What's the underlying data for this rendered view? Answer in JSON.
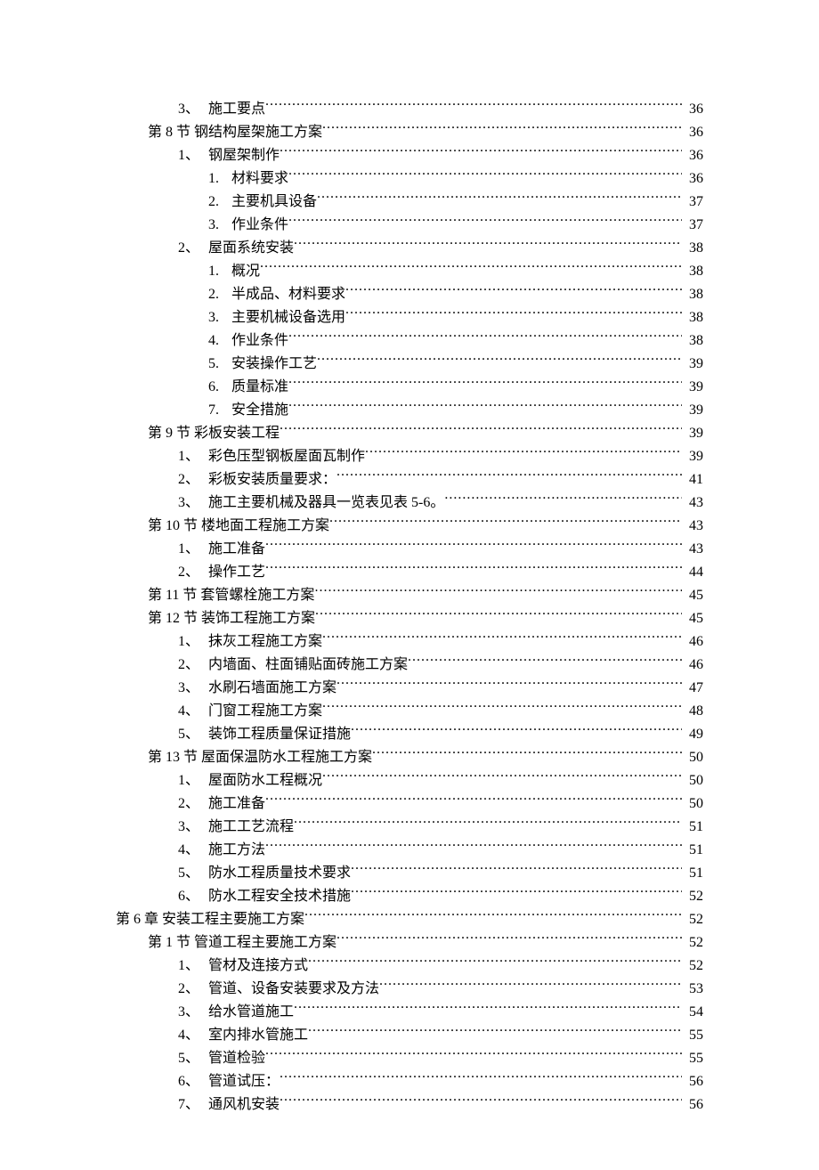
{
  "entries": [
    {
      "indent": 2,
      "num": "3、",
      "title": "施工要点",
      "page": "36"
    },
    {
      "indent": 1,
      "num": "第 8 节",
      "title": " 钢结构屋架施工方案",
      "page": "36"
    },
    {
      "indent": 2,
      "num": "1、",
      "title": "钢屋架制作",
      "page": "36"
    },
    {
      "indent": 3,
      "num": "1.",
      "title": " 材料要求",
      "page": "36"
    },
    {
      "indent": 3,
      "num": "2.",
      "title": " 主要机具设备",
      "page": "37"
    },
    {
      "indent": 3,
      "num": "3.",
      "title": " 作业条件",
      "page": "37"
    },
    {
      "indent": 2,
      "num": "2、",
      "title": "屋面系统安装",
      "page": "38"
    },
    {
      "indent": 3,
      "num": "1.",
      "title": " 概况",
      "page": "38"
    },
    {
      "indent": 3,
      "num": "2.",
      "title": " 半成品、材料要求",
      "page": "38"
    },
    {
      "indent": 3,
      "num": "3.",
      "title": " 主要机械设备选用",
      "page": "38"
    },
    {
      "indent": 3,
      "num": "4.",
      "title": " 作业条件",
      "page": "38"
    },
    {
      "indent": 3,
      "num": "5.",
      "title": " 安装操作工艺",
      "page": "39"
    },
    {
      "indent": 3,
      "num": "6.",
      "title": " 质量标准",
      "page": "39"
    },
    {
      "indent": 3,
      "num": "7.",
      "title": " 安全措施",
      "page": "39"
    },
    {
      "indent": 1,
      "num": "第 9 节",
      "title": " 彩板安装工程",
      "page": "39"
    },
    {
      "indent": 2,
      "num": "1、",
      "title": "彩色压型钢板屋面瓦制作",
      "page": "39"
    },
    {
      "indent": 2,
      "num": "2、",
      "title": "彩板安装质量要求：",
      "page": "41"
    },
    {
      "indent": 2,
      "num": "3、",
      "title": "施工主要机械及器具一览表见表 5-6。",
      "page": "43"
    },
    {
      "indent": 1,
      "num": "第 10 节",
      "title": " 楼地面工程施工方案",
      "page": "43"
    },
    {
      "indent": 2,
      "num": "1、",
      "title": "施工准备",
      "page": "43"
    },
    {
      "indent": 2,
      "num": "2、",
      "title": "操作工艺",
      "page": "44"
    },
    {
      "indent": 1,
      "num": "第 11 节",
      "title": " 套管螺栓施工方案",
      "page": "45"
    },
    {
      "indent": 1,
      "num": "第 12 节",
      "title": " 装饰工程施工方案",
      "page": "45"
    },
    {
      "indent": 2,
      "num": "1、",
      "title": "抹灰工程施工方案",
      "page": "46"
    },
    {
      "indent": 2,
      "num": "2、",
      "title": "内墙面、柱面铺贴面砖施工方案",
      "page": "46"
    },
    {
      "indent": 2,
      "num": "3、",
      "title": "水刷石墙面施工方案",
      "page": "47"
    },
    {
      "indent": 2,
      "num": "4、",
      "title": "门窗工程施工方案",
      "page": "48"
    },
    {
      "indent": 2,
      "num": "5、",
      "title": "装饰工程质量保证措施",
      "page": "49"
    },
    {
      "indent": 1,
      "num": "第 13 节",
      "title": " 屋面保温防水工程施工方案",
      "page": "50"
    },
    {
      "indent": 2,
      "num": "1、",
      "title": "屋面防水工程概况",
      "page": "50"
    },
    {
      "indent": 2,
      "num": "2、",
      "title": "施工准备",
      "page": "50"
    },
    {
      "indent": 2,
      "num": "3、",
      "title": "施工工艺流程",
      "page": "51"
    },
    {
      "indent": 2,
      "num": "4、",
      "title": "施工方法",
      "page": "51"
    },
    {
      "indent": 2,
      "num": "5、",
      "title": "防水工程质量技术要求",
      "page": "51"
    },
    {
      "indent": 2,
      "num": "6、",
      "title": "防水工程安全技术措施",
      "page": "52"
    },
    {
      "indent": 0,
      "num": "第 6 章",
      "title": " 安装工程主要施工方案",
      "page": "52"
    },
    {
      "indent": 1,
      "num": "第 1 节",
      "title": " 管道工程主要施工方案",
      "page": "52"
    },
    {
      "indent": 2,
      "num": "1、",
      "title": "管材及连接方式",
      "page": "52"
    },
    {
      "indent": 2,
      "num": "2、",
      "title": "管道、设备安装要求及方法",
      "page": "53"
    },
    {
      "indent": 2,
      "num": "3、",
      "title": "给水管道施工",
      "page": "54"
    },
    {
      "indent": 2,
      "num": "4、",
      "title": "室内排水管施工",
      "page": "55"
    },
    {
      "indent": 2,
      "num": "5、",
      "title": "管道检验",
      "page": "55"
    },
    {
      "indent": 2,
      "num": "6、",
      "title": "管道试压：",
      "page": "56"
    },
    {
      "indent": 2,
      "num": "7、",
      "title": "通风机安装",
      "page": "56"
    }
  ]
}
